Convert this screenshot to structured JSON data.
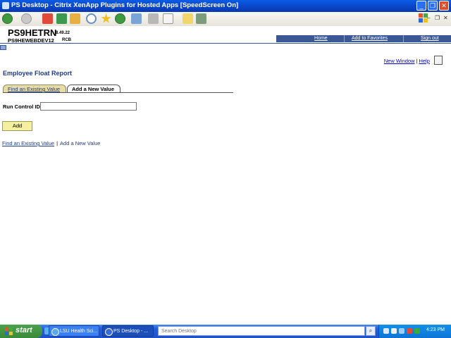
{
  "window": {
    "title": "PS Desktop - Citrix XenApp Plugins for Hosted Apps [SpeedScreen On]",
    "minimize_glyph": "_",
    "maximize_glyph": "❐",
    "close_glyph": "✕"
  },
  "toolbar": {
    "icons": [
      "back-icon",
      "forward-icon",
      "stop-icon",
      "refresh-icon",
      "home-icon",
      "search-icon",
      "favorites-icon",
      "history-icon",
      "mail-icon",
      "print-icon",
      "edit-icon",
      "folder-icon",
      "messenger-icon"
    ],
    "inner_min": "–",
    "inner_restore": "❐",
    "inner_close": "✕"
  },
  "ps_header": {
    "system_name": "PS9HETRN",
    "tools_version": "8.49.22",
    "database_name": "PS9HEWEBDEV12",
    "site_code": "RCB",
    "nav_links": {
      "home": "Home",
      "add_to_favorites": "Add to Favorites",
      "sign_out": "Sign out"
    }
  },
  "page": {
    "top_links": {
      "new_window": "New Window",
      "separator": "|",
      "help": "Help"
    },
    "title": "Employee Float Report",
    "tabs": {
      "find_existing": "Find an Existing Value",
      "add_new": "Add a New Value"
    },
    "run_control_label": "Run Control ID:",
    "run_control_value": "",
    "add_button": "Add",
    "bottom_links": {
      "find_existing": "Find an Existing Value",
      "separator": "|",
      "add_new": "Add a New Value"
    }
  },
  "taskbar": {
    "start_label": "start",
    "tasks": [
      "LSU Health Sci...",
      "PS Desktop - ..."
    ],
    "search_placeholder": "Search Desktop",
    "clock": "4:23 PM"
  },
  "colors": {
    "titlebar": "#0b47c9",
    "ps_nav": "#3a5894",
    "page_title": "#1f3b8a",
    "tab_inactive": "#e6dca4",
    "add_button": "#f5f0a0",
    "taskbar": "#245edc",
    "start_button": "#3a8a3a"
  }
}
